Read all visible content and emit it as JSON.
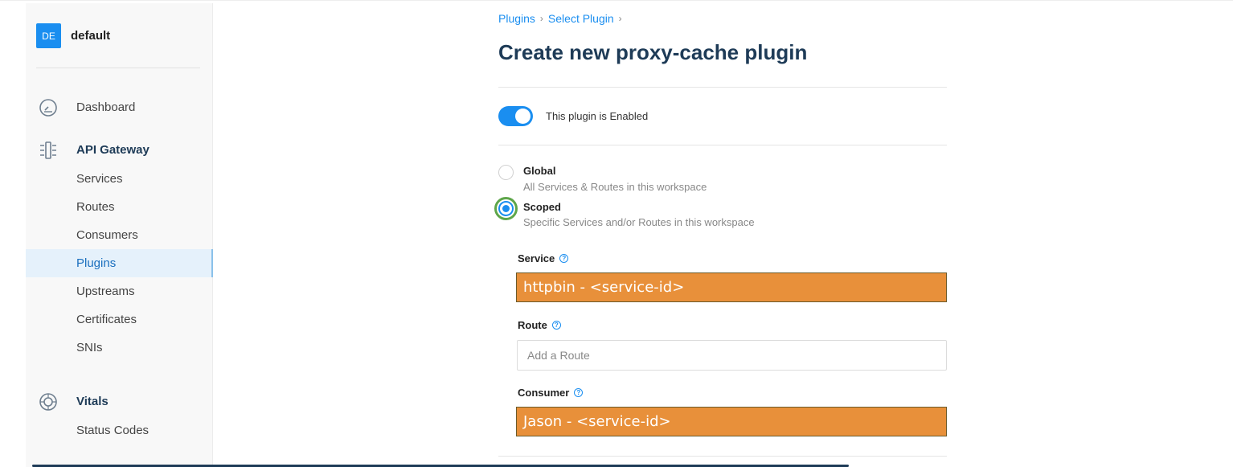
{
  "workspace": {
    "badge": "DE",
    "name": "default"
  },
  "sidebar": {
    "dashboard": "Dashboard",
    "api_gateway": {
      "title": "API Gateway",
      "items": [
        "Services",
        "Routes",
        "Consumers",
        "Plugins",
        "Upstreams",
        "Certificates",
        "SNIs"
      ],
      "active": "Plugins"
    },
    "vitals": {
      "title": "Vitals",
      "items": [
        "Status Codes"
      ]
    }
  },
  "breadcrumb": [
    "Plugins",
    "Select Plugin"
  ],
  "breadcrumb_separator": "›",
  "page_title": "Create new proxy-cache plugin",
  "enabled_toggle": {
    "label": "This plugin is Enabled",
    "on": true
  },
  "scope": {
    "global": {
      "title": "Global",
      "description": "All Services & Routes in this workspace"
    },
    "scoped": {
      "title": "Scoped",
      "description": "Specific Services and/or Routes in this workspace"
    },
    "selected": "scoped"
  },
  "fields": {
    "service": {
      "label": "Service",
      "value": "httpbin - <service-id>"
    },
    "route": {
      "label": "Route",
      "placeholder": "Add a Route"
    },
    "consumer": {
      "label": "Consumer",
      "value": "Jason - <service-id>"
    }
  },
  "help_glyph": "?",
  "colors": {
    "accent": "#1a8ef0",
    "title": "#1e3b57",
    "highlight": "#e8903a",
    "focus_ring": "#5ea64a"
  }
}
